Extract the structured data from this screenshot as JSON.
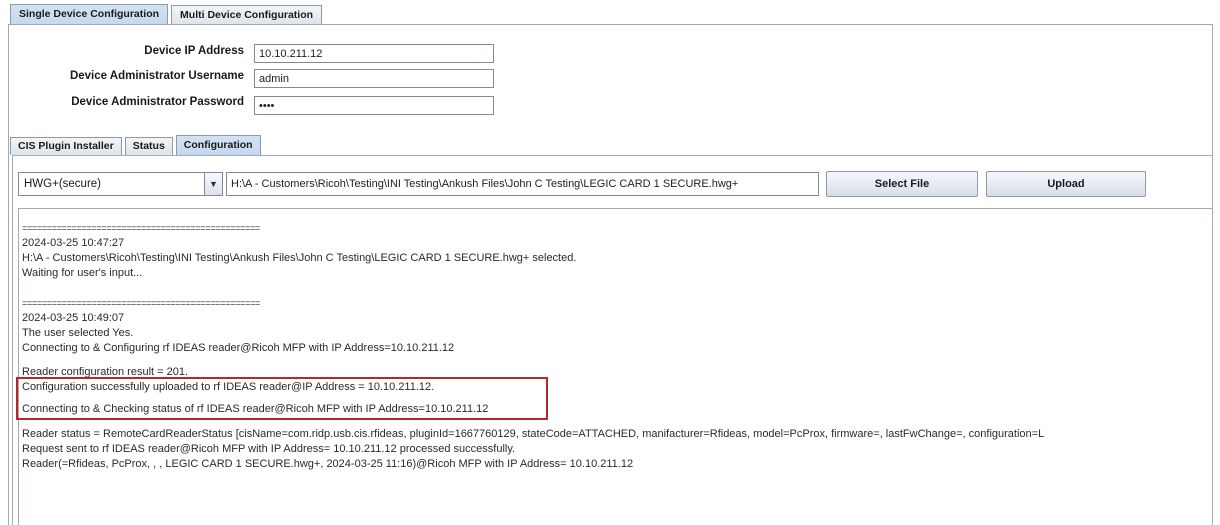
{
  "top_tabs": [
    {
      "label": "Single Device Configuration",
      "active": true
    },
    {
      "label": "Multi Device Configuration",
      "active": false
    }
  ],
  "device": {
    "ip_label": "Device IP Address",
    "ip_value": "10.10.211.12",
    "username_label": "Device Administrator Username",
    "username_value": "admin",
    "password_label": "Device Administrator Password",
    "password_value": "••••"
  },
  "inner_tabs": [
    {
      "label": "CIS Plugin Installer",
      "active": false
    },
    {
      "label": "Status",
      "active": false
    },
    {
      "label": "Configuration",
      "active": true
    }
  ],
  "config": {
    "format_selected": "HWG+(secure)",
    "file_path": "H:\\A - Customers\\Ricoh\\Testing\\INI Testing\\Ankush Files\\John C Testing\\LEGIC CARD 1 SECURE.hwg+",
    "select_file_label": "Select File",
    "upload_label": "Upload"
  },
  "log": {
    "separator": "================================================",
    "block1": {
      "timestamp": "2024-03-25 10:47:27",
      "selected": "H:\\A - Customers\\Ricoh\\Testing\\INI Testing\\Ankush Files\\John C Testing\\LEGIC CARD 1 SECURE.hwg+ selected.",
      "waiting": "Waiting for user's input..."
    },
    "block2": {
      "timestamp": "2024-03-25 10:49:07",
      "user_selected": "The user selected Yes.",
      "connecting": "Connecting to & Configuring rf IDEAS reader@Ricoh MFP with IP Address=10.10.211.12",
      "result": "Reader configuration result = 201.",
      "success": "Configuration successfully uploaded to rf IDEAS reader@IP Address = 10.10.211.12.",
      "checking": "Connecting to & Checking status of rf IDEAS reader@Ricoh MFP with IP Address=10.10.211.12",
      "status": "Reader status = RemoteCardReaderStatus [cisName=com.ridp.usb.cis.rfideas, pluginId=1667760129, stateCode=ATTACHED, manifacturer=Rfideas, model=PcProx, firmware=, lastFwChange=, configuration=L",
      "request": "Request sent to rf IDEAS reader@Ricoh MFP with IP Address= 10.10.211.12 processed successfully.",
      "reader": "Reader(=Rfideas, PcProx, , , LEGIC CARD 1 SECURE.hwg+, 2024-03-25 11:16)@Ricoh MFP with IP Address= 10.10.211.12"
    }
  },
  "highlight_color": "#b7262b"
}
